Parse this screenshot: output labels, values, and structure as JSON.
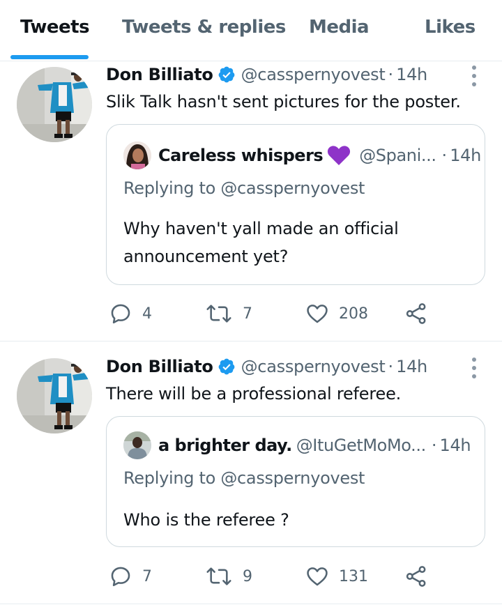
{
  "tabs": [
    {
      "label": "Tweets",
      "active": true
    },
    {
      "label": "Tweets & replies",
      "active": false
    },
    {
      "label": "Media",
      "active": false
    },
    {
      "label": "Likes",
      "active": false
    }
  ],
  "colors": {
    "accent": "#1d9bf0",
    "verified": "#1d9bf0",
    "heart_emoji": "#8e33c8",
    "muted_text": "#536471"
  },
  "tweets": [
    {
      "author_name": "Don Billiato",
      "handle": "@casspernyovest",
      "dot": "·",
      "time": "14h",
      "text": "Slik Talk hasn't sent pictures for the poster.",
      "quote": {
        "name": "Careless whispers",
        "name_emoji": "purple-heart-icon",
        "handle": "@Spani...",
        "dot": "·",
        "time": "14h",
        "replying": "Replying to @casspernyovest",
        "text": "Why haven't yall made an official announcement yet?"
      },
      "replies": "4",
      "retweets": "7",
      "likes": "208"
    },
    {
      "author_name": "Don Billiato",
      "handle": "@casspernyovest",
      "dot": "·",
      "time": "14h",
      "text": "There will be a professional referee.",
      "quote": {
        "name": "a brighter day.",
        "handle": "@ItuGetMoMo...",
        "dot": "·",
        "time": "14h",
        "replying": "Replying to @casspernyovest",
        "text": "Who is the referee ?"
      },
      "replies": "7",
      "retweets": "9",
      "likes": "131"
    }
  ]
}
